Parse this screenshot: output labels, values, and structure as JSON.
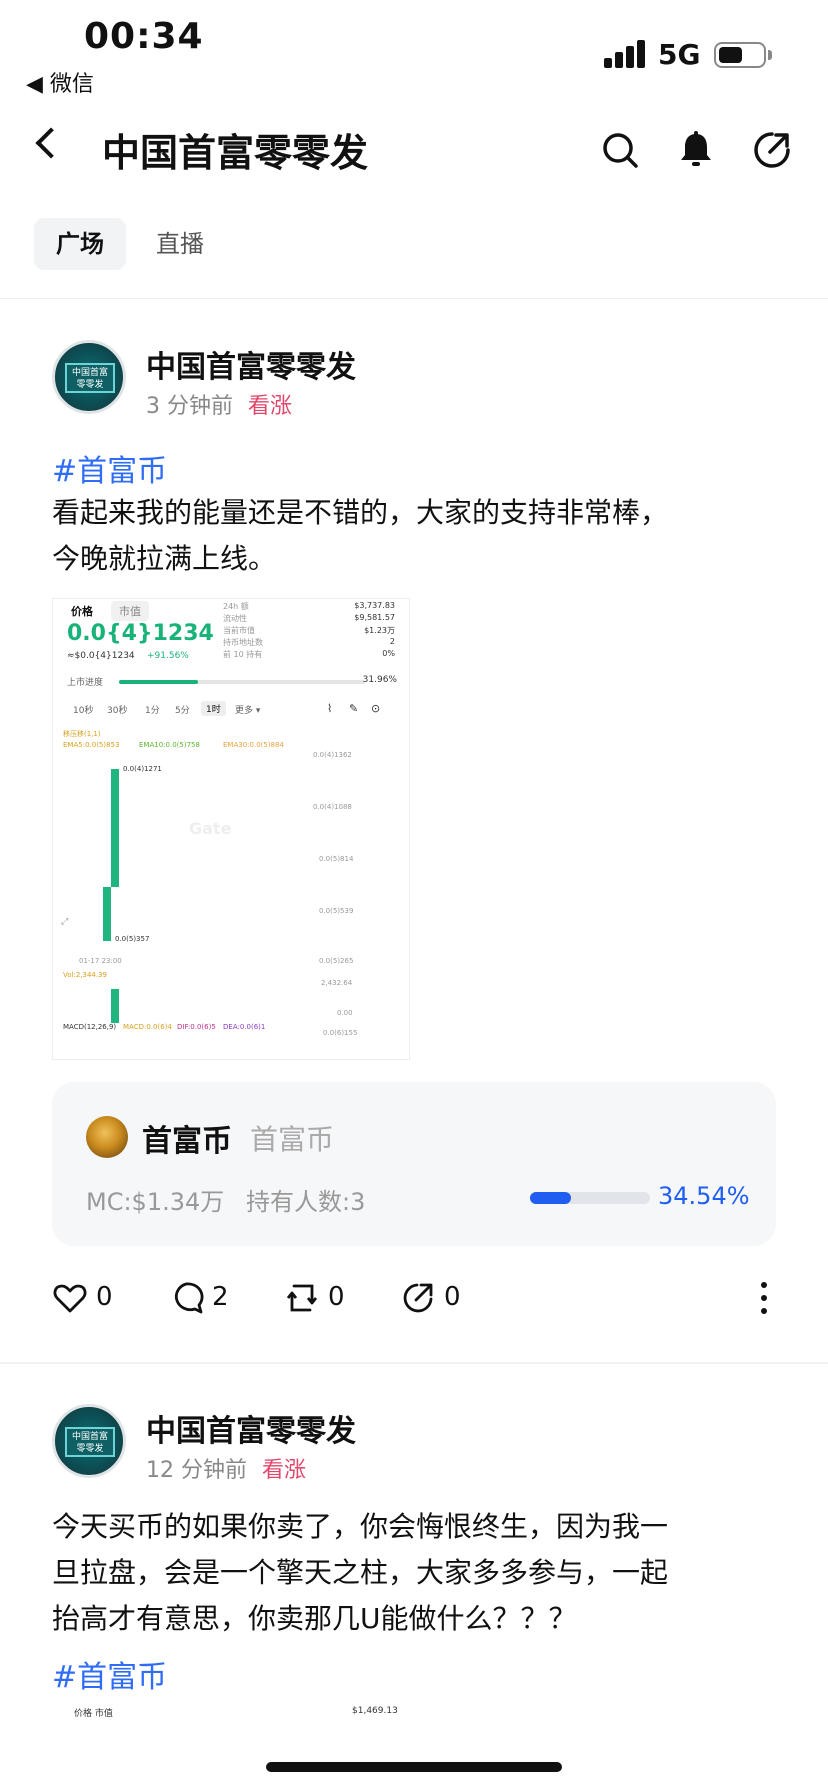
{
  "status": {
    "time": "00:34",
    "back_app": "◀ 微信",
    "network": "5G",
    "battery_level": 0.55
  },
  "header": {
    "title": "中国首富零零发"
  },
  "tabs": [
    {
      "label": "广场",
      "active": true
    },
    {
      "label": "直播",
      "active": false
    }
  ],
  "posts": [
    {
      "author": "中国首富零零发",
      "avatar_text": "中国首富\n零零发",
      "time": "3 分钟前",
      "sentiment": "看涨",
      "hashtag": "#首富币",
      "text_lines": [
        "看起来我的能量还是不错的，大家的支持非常棒，",
        "今晚就拉满上线。"
      ],
      "chart_image": {
        "tab_price": "价格",
        "tab_mcap": "市值",
        "price": "0.0{4}1234",
        "price_usd": "≈$0.0{4}1234",
        "change": "+91.56%",
        "stats": [
          {
            "label": "24h 额",
            "value": "$3,737.83"
          },
          {
            "label": "流动性",
            "value": "$9,581.57"
          },
          {
            "label": "当前市值",
            "value": "$1.23万"
          },
          {
            "label": "持币地址数",
            "value": "2"
          },
          {
            "label": "前 10 持有",
            "value": "0%"
          }
        ],
        "listing_label": "上市进度",
        "listing_pct": "31.96%",
        "listing_fraction": 0.3196,
        "intervals": [
          "10秒",
          "30秒",
          "1分",
          "5分",
          "1时",
          "更多 ▾"
        ],
        "indicator_title": "移压移(1,1)",
        "ema5": "EMA5:0.0(5)853",
        "ema10": "EMA10:0.0(5)758",
        "ema30": "EMA30:0.0(5)884",
        "high_label": "0.0(4)1271",
        "low_label": "0.0(5)357",
        "axis": [
          "0.0(4)1362",
          "0.0(4)1088",
          "0.0(5)814",
          "0.0(5)539",
          "0.0(5)265"
        ],
        "watermark": "Gate",
        "date": "01-17 23:00",
        "vol": "Vol:2,344.39",
        "vol_axis": [
          "2,432.64",
          "0.00"
        ],
        "macd": "MACD(12,26,9)",
        "macd_val": "MACD:0.0(6)4",
        "dif": "DIF:0.0(6)5",
        "dea": "DEA:0.0(6)1",
        "macd_axis": "0.0(6)155"
      },
      "token": {
        "name": "首富币",
        "sub": "首富币",
        "mc": "MC:$1.34万",
        "holders": "持有人数:3",
        "progress_pct": "34.54%",
        "progress_fraction": 0.3454
      },
      "likes": "0",
      "comments": "2",
      "reposts": "0",
      "shares": "0"
    },
    {
      "author": "中国首富零零发",
      "avatar_text": "中国首富\n零零发",
      "time": "12 分钟前",
      "sentiment": "看涨",
      "text_lines": [
        "今天买币的如果你卖了，你会悔恨终生，因为我一",
        "旦拉盘，会是一个擎天之柱，大家多多参与，一起",
        "抬高才有意思，你卖那几U能做什么？？？"
      ],
      "hashtag": "#首富币",
      "preview_left": "价格  市值",
      "preview_right": "$1,469.13"
    }
  ]
}
